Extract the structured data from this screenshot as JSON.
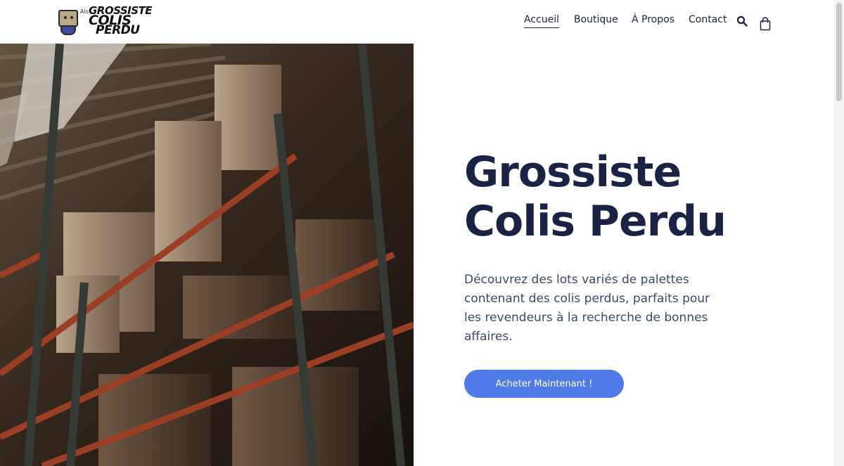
{
  "header": {
    "logo": {
      "tag": "Als",
      "line1": "GROSSISTE",
      "line2": "COLIS",
      "line3": "PERDU"
    },
    "nav": [
      {
        "label": "Accueil",
        "active": true
      },
      {
        "label": "Boutique",
        "active": false
      },
      {
        "label": "À Propos",
        "active": false
      },
      {
        "label": "Contact",
        "active": false
      }
    ],
    "icons": [
      "search-icon",
      "cart-icon"
    ]
  },
  "hero": {
    "image": "warehouse-shelves-with-boxes",
    "title_line1": "Grossiste",
    "title_line2": "Colis Perdu",
    "description": "Découvrez des lots variés de palettes contenant des colis perdus, parfaits pour les revendeurs à la recherche de bonnes affaires.",
    "cta_label": "Acheter Maintenant !"
  },
  "colors": {
    "primary": "#1b2345",
    "accent": "#4f7ae8",
    "text": "#3a4a68"
  }
}
